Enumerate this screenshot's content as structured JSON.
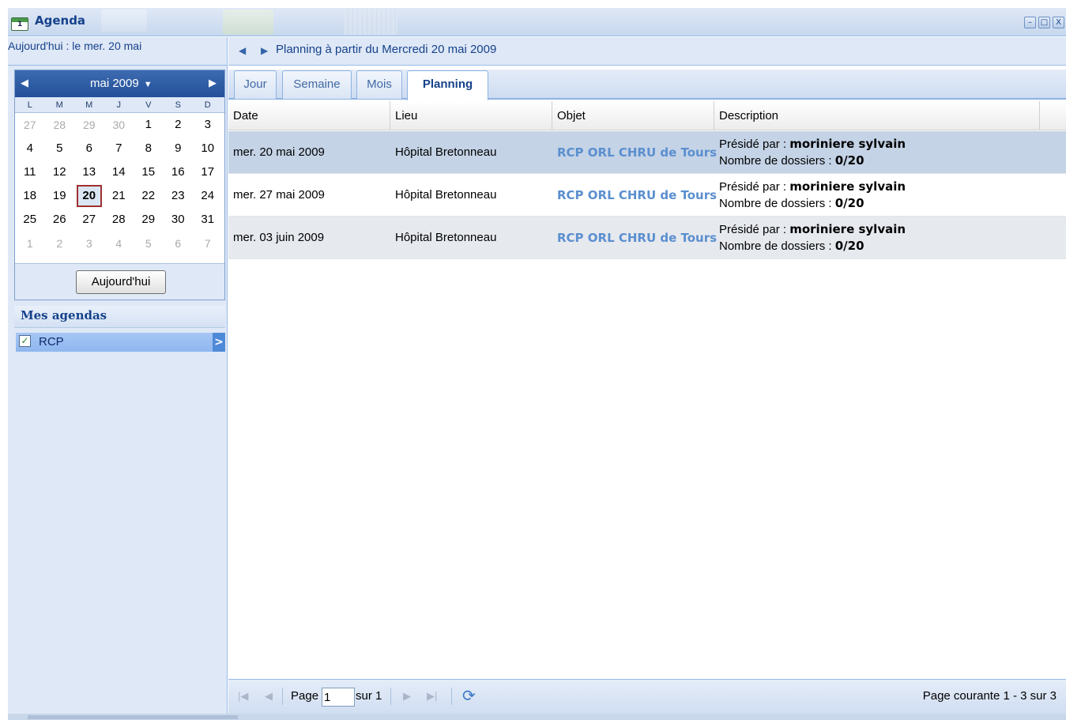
{
  "window": {
    "title": "Agenda",
    "buttons": [
      "–",
      "□",
      "X"
    ]
  },
  "left": {
    "today_text": "Aujourd'hui : le mer. 20 mai",
    "calendar": {
      "month_label": "mai 2009",
      "weekdays": [
        "L",
        "M",
        "M",
        "J",
        "V",
        "S",
        "D"
      ],
      "weeks": [
        [
          "27",
          "28",
          "29",
          "30",
          "1",
          "2",
          "3"
        ],
        [
          "4",
          "5",
          "6",
          "7",
          "8",
          "9",
          "10"
        ],
        [
          "11",
          "12",
          "13",
          "14",
          "15",
          "16",
          "17"
        ],
        [
          "18",
          "19",
          "20",
          "21",
          "22",
          "23",
          "24"
        ],
        [
          "25",
          "26",
          "27",
          "28",
          "29",
          "30",
          "31"
        ],
        [
          "1",
          "2",
          "3",
          "4",
          "5",
          "6",
          "7"
        ]
      ],
      "selected_day": "20",
      "today_button": "Aujourd'hui"
    },
    "agendas": {
      "title": "Mes agendas",
      "items": [
        {
          "label": "RCP",
          "checked": true
        }
      ]
    }
  },
  "main": {
    "nav_title": "Planning à partir du Mercredi 20 mai 2009",
    "tabs": [
      {
        "label": "Jour",
        "active": false
      },
      {
        "label": "Semaine",
        "active": false
      },
      {
        "label": "Mois",
        "active": false
      },
      {
        "label": "Planning",
        "active": true
      }
    ],
    "columns": [
      "Date",
      "Lieu",
      "Objet",
      "Description"
    ],
    "rows": [
      {
        "date": "mer. 20 mai 2009",
        "lieu": "Hôpital Bretonneau",
        "objet": "RCP ORL CHRU de Tours",
        "desc1_prefix": "Présidé par : ",
        "desc1_bold": "moriniere sylvain",
        "desc2_prefix": "Nombre de dossiers : ",
        "desc2_bold": "0/20"
      },
      {
        "date": "mer. 27 mai 2009",
        "lieu": "Hôpital Bretonneau",
        "objet": "RCP ORL CHRU de Tours",
        "desc1_prefix": "Présidé par : ",
        "desc1_bold": "moriniere sylvain",
        "desc2_prefix": "Nombre de dossiers : ",
        "desc2_bold": "0/20"
      },
      {
        "date": "mer. 03 juin 2009",
        "lieu": "Hôpital Bretonneau",
        "objet": "RCP ORL CHRU de Tours",
        "desc1_prefix": "Présidé par : ",
        "desc1_bold": "moriniere sylvain",
        "desc2_prefix": "Nombre de dossiers : ",
        "desc2_bold": "0/20"
      }
    ],
    "pager": {
      "page_label": "Page",
      "page_value": "1",
      "of_label": "sur 1",
      "status": "Page courante 1 - 3 sur 3"
    }
  },
  "colors": {
    "header_blue": "#15428b",
    "calendar_head": "#23509a",
    "link_blue": "#5b8fcf",
    "selected_row": "#c4d3e6"
  }
}
